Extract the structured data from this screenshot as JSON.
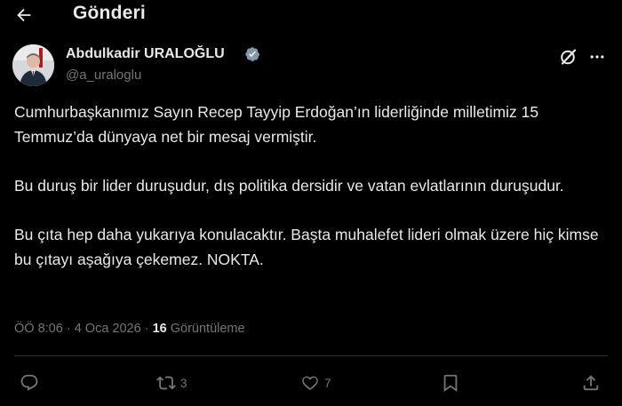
{
  "header": {
    "back_icon": "arrow-left-icon",
    "title": "Gönderi"
  },
  "author": {
    "name": "Abdulkadir URALOĞLU",
    "handle": "@a_uraloglu",
    "verified_icon": "verified-badge-icon",
    "verified_color": "#71767b"
  },
  "tweet": {
    "paragraphs": [
      "Cumhurbaşkanımız Sayın Recep Tayyip Erdoğan’ın liderliğinde milletimiz 15 Temmuz’da dünyaya net bir mesaj vermiştir.",
      "Bu duruş bir lider duruşudur, dış politika dersidir ve vatan evlatlarının duruşudur.",
      "Bu çıta hep daha yukarıya konulacaktır. Başta muhalefet lideri olmak üzere hiç kimse bu çıtayı aşağıya çekemez. NOKTA."
    ]
  },
  "meta": {
    "time": "ÖÖ 8:06",
    "separator": " · ",
    "date": "4 Oca 2026",
    "views_count": "16",
    "views_label": "Görüntüleme"
  },
  "actions": {
    "reply": {
      "icon": "reply-icon",
      "count": ""
    },
    "retweet": {
      "icon": "retweet-icon",
      "count": "3"
    },
    "like": {
      "icon": "heart-icon",
      "count": "7"
    },
    "bookmark": {
      "icon": "bookmark-icon",
      "count": ""
    },
    "share": {
      "icon": "share-icon",
      "count": ""
    }
  },
  "top_icons": {
    "grok": "grok-icon",
    "more": "more-dots-icon"
  },
  "colors": {
    "background": "#000000",
    "text_primary": "#e7e9ea",
    "text_secondary": "#71767b",
    "divider": "#2f3336"
  }
}
